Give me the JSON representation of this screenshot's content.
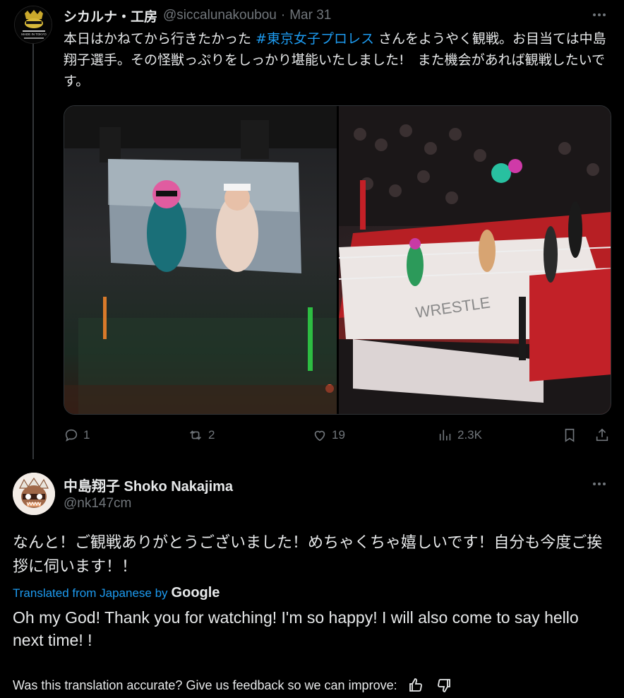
{
  "tweet1": {
    "name": "シカルナ・工房",
    "handle": "@siccalunakoubou",
    "separator": "·",
    "date": "Mar 31",
    "text_before": "本日はかねてから行きたかった ",
    "hashtag": "#東京女子プロレス",
    "text_after": " さんをようやく観戦。お目当ては中島翔子選手。その怪獣っぷりをしっかり堪能いたしました!　また機会があれば観戦したいです。",
    "avatar_text": "MADE IN TOKYO",
    "stats": {
      "replies": "1",
      "retweets": "2",
      "likes": "19",
      "views": "2.3K"
    }
  },
  "tweet2": {
    "name": "中島翔子 Shoko Nakajima",
    "handle": "@nk147cm",
    "text": "なんと！ご観戦ありがとうございました！めちゃくちゃ嬉しいです！自分も今度ご挨拶に伺います！！",
    "translated_label": "Translated from Japanese by",
    "google": "Google",
    "translation": "Oh my God! Thank you for watching! I'm so happy! I will also come to say hello next time! !",
    "feedback_prompt": "Was this translation accurate? Give us feedback so we can improve:"
  },
  "colors": {
    "accent": "#1d9bf0",
    "muted": "#71767b",
    "text": "#e7e9ea",
    "background": "#000000"
  },
  "icons": [
    "more-icon",
    "reply-icon",
    "retweet-icon",
    "like-icon",
    "views-icon",
    "bookmark-icon",
    "share-icon",
    "thumbs-up-icon",
    "thumbs-down-icon"
  ]
}
